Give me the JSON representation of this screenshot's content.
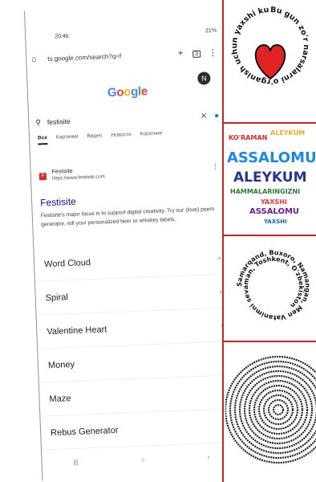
{
  "status": {
    "time": "20:46",
    "battery": "21%"
  },
  "browser": {
    "url": "ts.google.com/search?q=f",
    "tab_count": "3",
    "home_icon": "home-icon",
    "new_tab_icon": "plus-icon",
    "menu_icon": "kebab-icon"
  },
  "google": {
    "logo_letters": [
      "G",
      "o",
      "o",
      "g",
      "l",
      "e"
    ],
    "avatar_letter": "N"
  },
  "search": {
    "query": "festisite"
  },
  "tabs": [
    "Все",
    "Картинки",
    "Видео",
    "Новости",
    "Короткие"
  ],
  "result": {
    "favicon_letter": "F",
    "site_name": "Festisite",
    "cite": "https://www.festisite.com",
    "title": "Festisite",
    "snippet": "Festisite's major focus is to support digital creativity. Try our (love) poem generator, roll your personalized beer or whiskey labels."
  },
  "sitelinks": [
    "Word Cloud",
    "Spiral",
    "Valentine Heart",
    "Money",
    "Maze",
    "Rebus Generator"
  ],
  "colors": {
    "accent_red": "#d62020",
    "link_blue": "#1a0dab"
  },
  "art": {
    "circle_text": "Bu gun zo'r narsalarni o'rganish uchun yaxshi kun",
    "heart_words": [
      "KO'RAMAN",
      "ALEYKUM",
      "ASSALOMU",
      "ALEYKUM",
      "HAMMALARINGIZNI",
      "YAXSHI",
      "ASSALOMU",
      "YAXSHI"
    ],
    "spiral_text": "Samarqand, Buxoro, Namangan, Men Vatanimni sevaman, Toshkent, O'zbekiston"
  }
}
